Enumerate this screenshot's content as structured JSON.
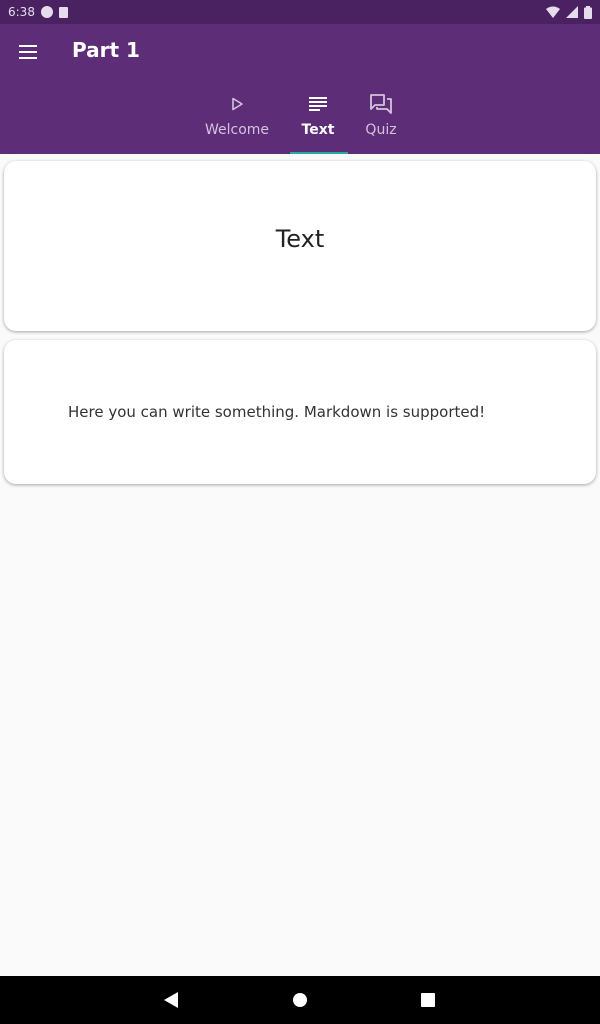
{
  "status_bar": {
    "time": "6:38",
    "icons": [
      "data-saver-icon",
      "sd-card-icon",
      "wifi-icon",
      "signal-icon",
      "battery-icon"
    ]
  },
  "app_bar": {
    "title": "Part 1",
    "background": "#5e2d77",
    "menu_icon": "hamburger-menu-icon"
  },
  "tabs": [
    {
      "label": "Welcome",
      "icon": "play-icon",
      "active": false
    },
    {
      "label": "Text",
      "icon": "notes-icon",
      "active": true
    },
    {
      "label": "Quiz",
      "icon": "forum-icon",
      "active": false
    }
  ],
  "cards": {
    "title_card": {
      "text": "Text"
    },
    "content_card": {
      "text": "Here you can write something. Markdown is supported!"
    }
  },
  "nav_bar": {
    "buttons": [
      "back-icon",
      "home-icon",
      "recents-icon"
    ]
  }
}
